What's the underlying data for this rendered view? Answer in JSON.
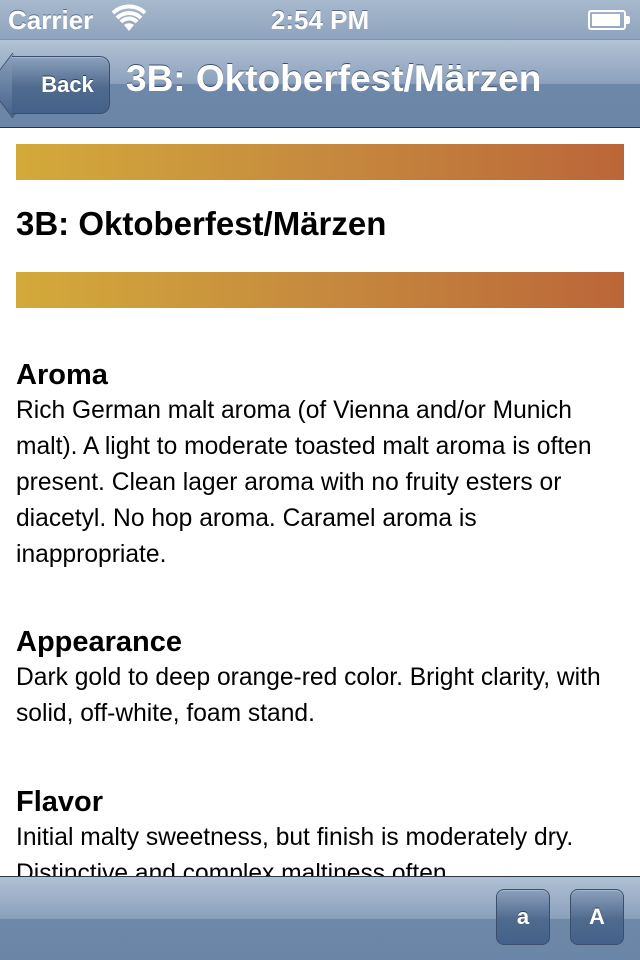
{
  "status_bar": {
    "carrier": "Carrier",
    "time": "2:54 PM",
    "battery_level": 0.95
  },
  "nav": {
    "back_label": "Back",
    "title": "3B: Oktoberfest/Märzen"
  },
  "content": {
    "style_title": "3B: Oktoberfest/Märzen",
    "band_colors": [
      "#d3aa3a",
      "#c68a3e",
      "#bb6638"
    ],
    "sections": [
      {
        "heading": "Aroma",
        "text": "Rich German malt aroma (of Vienna and/or Munich malt). A light to moderate toasted malt aroma is often present. Clean lager aroma with no fruity esters or diacetyl. No hop aroma. Caramel aroma is inappropriate."
      },
      {
        "heading": "Appearance",
        "text": "Dark gold to deep orange-red color. Bright clarity, with solid, off-white, foam stand."
      },
      {
        "heading": "Flavor",
        "text": "Initial malty sweetness, but finish is moderately dry. Distinctive and complex maltiness often"
      }
    ]
  },
  "toolbar": {
    "smaller_text_label": "a",
    "larger_text_label": "A"
  }
}
